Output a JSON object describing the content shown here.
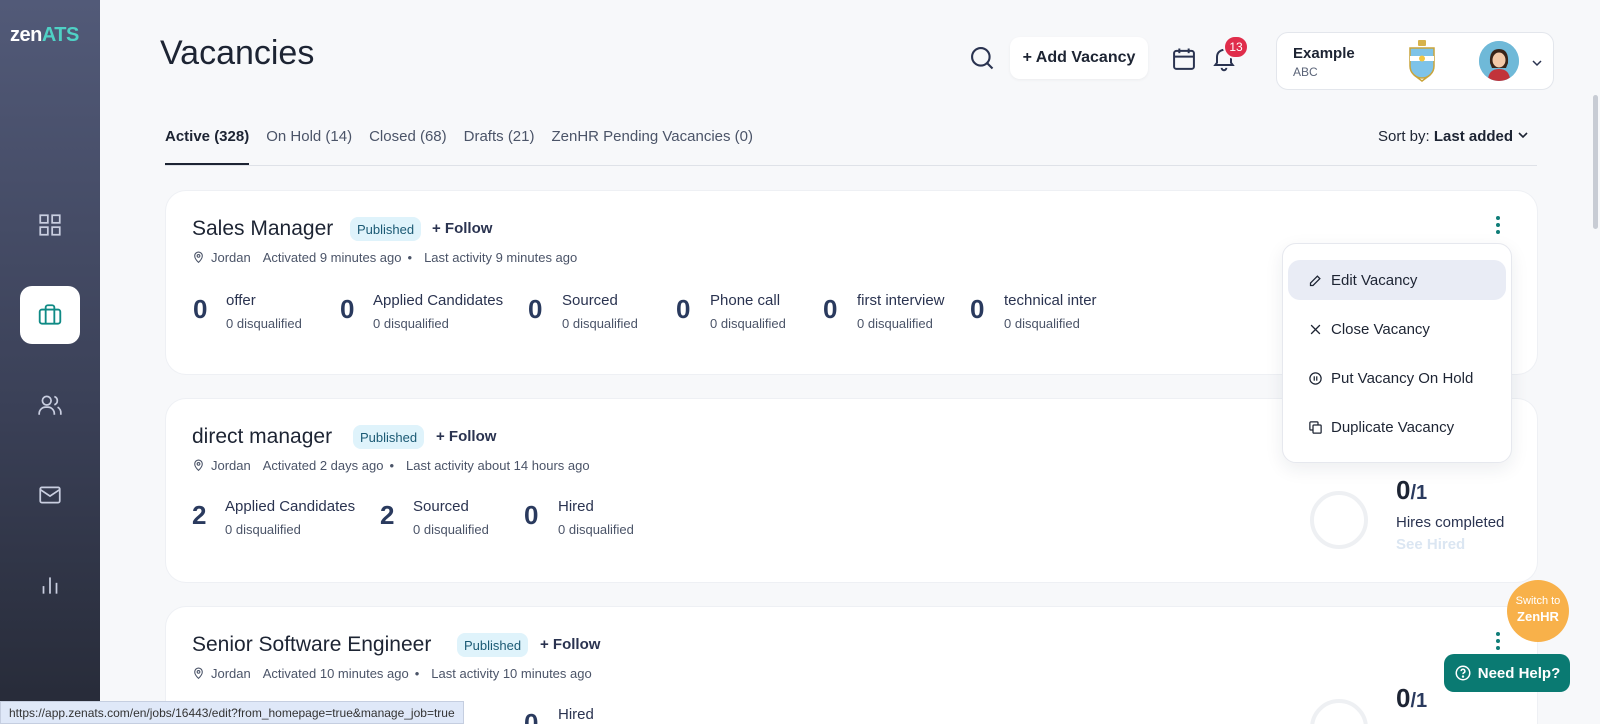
{
  "app": {
    "logo_prefix": "zen",
    "logo_suffix": "ATS"
  },
  "sidebar": {
    "items": [
      {
        "name": "dashboard",
        "icon": "grid-icon"
      },
      {
        "name": "vacancies",
        "icon": "briefcase-icon",
        "active": true
      },
      {
        "name": "candidates",
        "icon": "users-icon"
      },
      {
        "name": "messages",
        "icon": "mail-icon"
      },
      {
        "name": "reports",
        "icon": "bar-chart-icon"
      }
    ]
  },
  "header": {
    "title": "Vacancies",
    "add_vacancy_label": "+ Add Vacancy",
    "notification_count": "13",
    "account": {
      "name": "Example",
      "org": "ABC"
    }
  },
  "tabs": [
    {
      "label": "Active (328)",
      "active": true
    },
    {
      "label": "On Hold (14)"
    },
    {
      "label": "Closed (68)"
    },
    {
      "label": "Drafts (21)"
    },
    {
      "label": "ZenHR Pending Vacancies (0)"
    }
  ],
  "sort": {
    "prefix": "Sort by:",
    "value": "Last added"
  },
  "vacancies": [
    {
      "title": "Sales Manager",
      "status": "Published",
      "follow_label": "+ Follow",
      "location": "Jordan",
      "activated": "Activated 9 minutes ago",
      "last_activity": "Last activity 9 minutes ago",
      "stages": [
        {
          "count": "0",
          "name": "offer",
          "sub": "0 disqualified"
        },
        {
          "count": "0",
          "name": "Applied Candidates",
          "sub": "0 disqualified"
        },
        {
          "count": "0",
          "name": "Sourced",
          "sub": "0 disqualified"
        },
        {
          "count": "0",
          "name": "Phone call",
          "sub": "0 disqualified"
        },
        {
          "count": "0",
          "name": "first interview",
          "sub": "0 disqualified"
        },
        {
          "count": "0",
          "name": "technical inter",
          "sub": "0 disqualified"
        }
      ]
    },
    {
      "title": "direct manager",
      "status": "Published",
      "follow_label": "+ Follow",
      "location": "Jordan",
      "activated": "Activated 2 days ago",
      "last_activity": "Last activity about 14 hours ago",
      "stages": [
        {
          "count": "2",
          "name": "Applied Candidates",
          "sub": "0 disqualified"
        },
        {
          "count": "2",
          "name": "Sourced",
          "sub": "0 disqualified"
        },
        {
          "count": "0",
          "name": "Hired",
          "sub": "0 disqualified"
        }
      ],
      "hires": {
        "done": "0",
        "total": "/1",
        "label": "Hires completed",
        "link": "See Hired"
      }
    },
    {
      "title": "Senior Software Engineer",
      "status": "Published",
      "follow_label": "+ Follow",
      "location": "Jordan",
      "activated": "Activated 10 minutes ago",
      "last_activity": "Last activity 10 minutes ago",
      "stages": [
        {
          "count": "0",
          "name": "Hired",
          "sub": ""
        }
      ],
      "hires": {
        "done": "0",
        "total": "/1"
      }
    }
  ],
  "context_menu": {
    "items": [
      {
        "label": "Edit Vacancy",
        "icon": "pencil-icon",
        "highlighted": true
      },
      {
        "label": "Close Vacancy",
        "icon": "close-icon"
      },
      {
        "label": "Put Vacancy On Hold",
        "icon": "pause-icon"
      },
      {
        "label": "Duplicate Vacancy",
        "icon": "copy-icon"
      }
    ]
  },
  "floating": {
    "switch_line1": "Switch to",
    "switch_line2": "ZenHR",
    "help_label": "Need Help?"
  },
  "status_url": "https://app.zenats.com/en/jobs/16443/edit?from_homepage=true&manage_job=true",
  "colors": {
    "accent": "#0a7a72",
    "badge": "#e02d4b",
    "switch": "#f8b14a",
    "published_bg": "#dff3fb"
  }
}
